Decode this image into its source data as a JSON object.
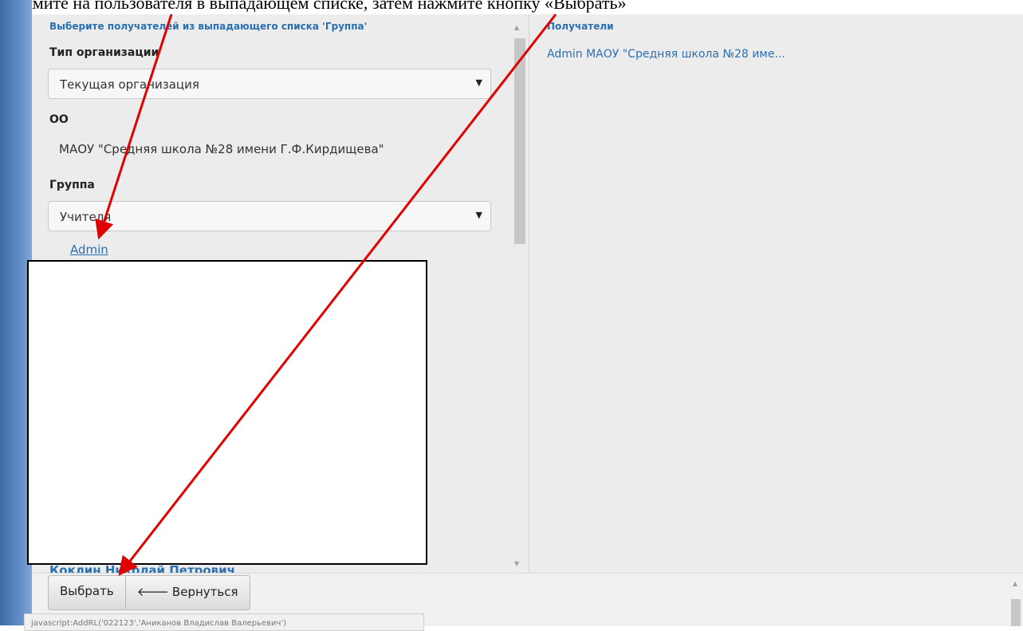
{
  "instruction_text": "Нажмите на пользователя в выпадающем списке, затем нажмите кнопку «Выбрать»",
  "left_pane": {
    "hint": "Выберите получателей из выпадающего списка 'Группа'",
    "org_type_label": "Тип организации",
    "org_type_value": "Текущая организация",
    "oo_label": "ОО",
    "oo_value": "МАОУ \"Средняя школа №28 имени Г.Ф.Кирдищева\"",
    "group_label": "Группа",
    "group_value": "Учителя",
    "admin_link": "Admin",
    "partial_list_item": "Коклин Николай Петрович"
  },
  "right_pane": {
    "header": "Получатели",
    "recipients": [
      "Admin МАОУ \"Средняя школа №28 име..."
    ]
  },
  "footer": {
    "select_button": "Выбрать",
    "back_button": "Вернуться",
    "status_text": "javascript:AddRL('022123','Аниканов Владислав Валерьевич')"
  },
  "icons": {
    "caret": "caret-down-icon",
    "back_arrow": "arrow-left-icon"
  },
  "colors": {
    "accent": "#2a6fb0",
    "annotation_arrow": "#e10000",
    "sidebar": "#4a78b6"
  }
}
